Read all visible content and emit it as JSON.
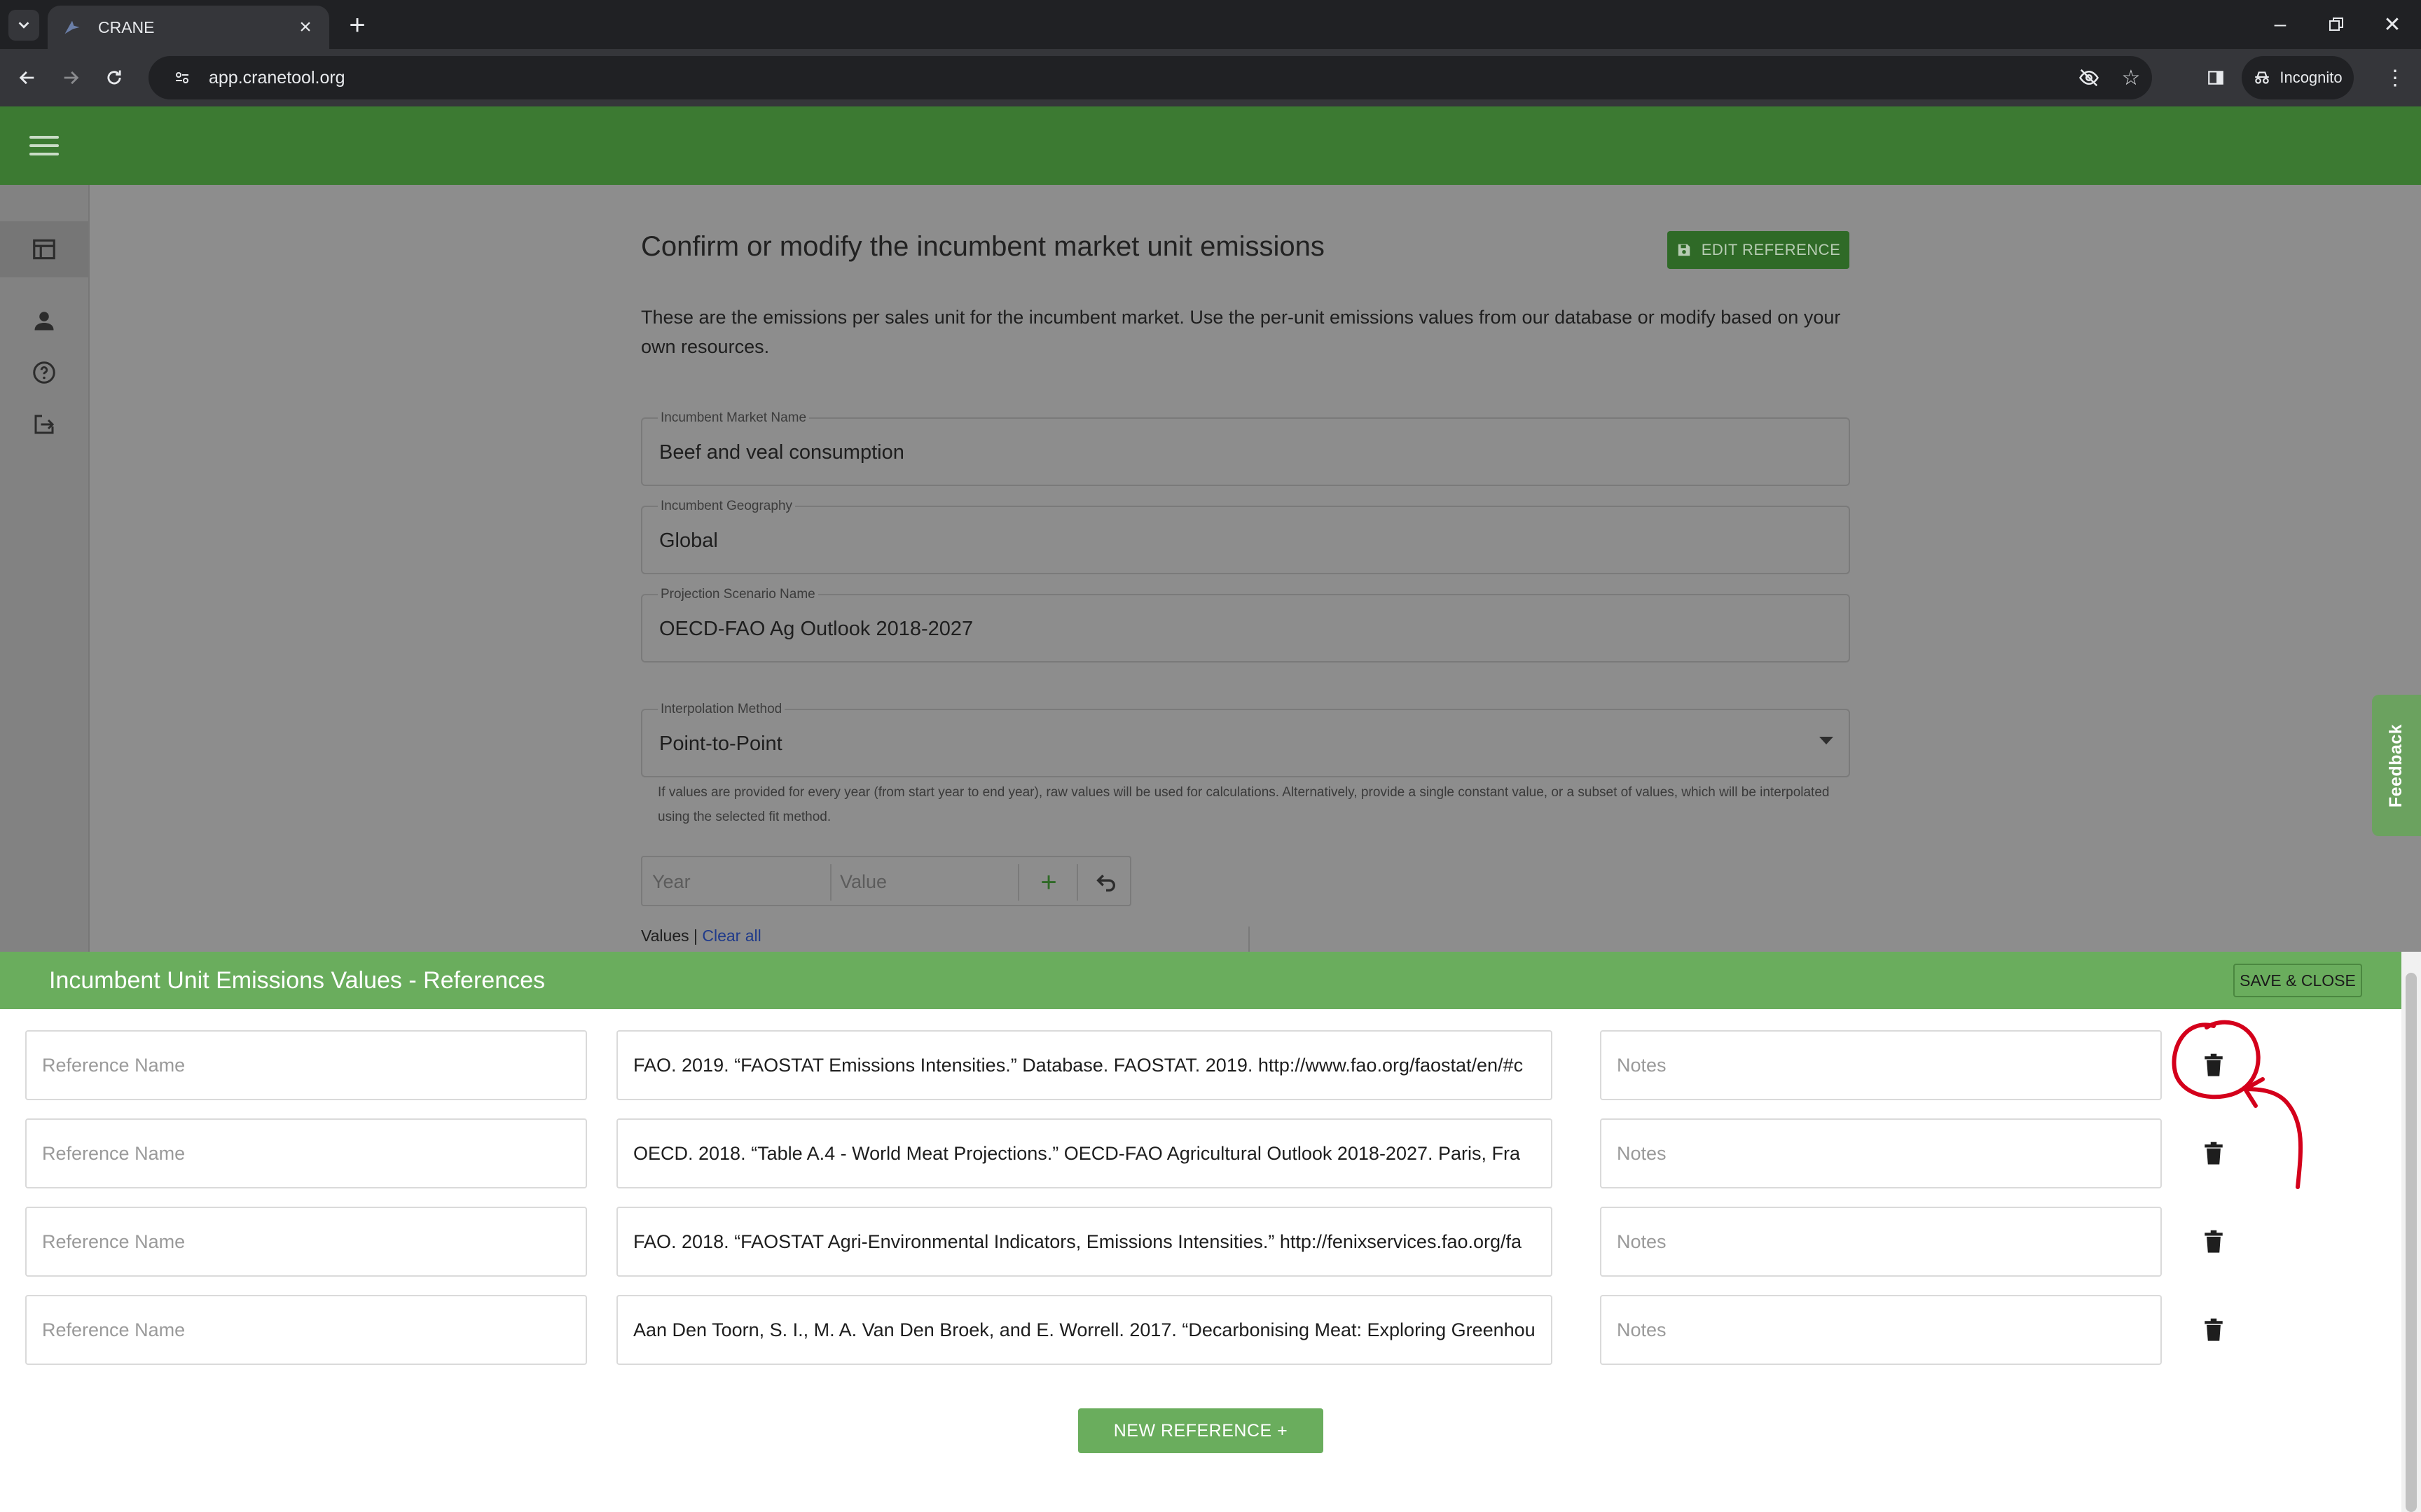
{
  "browser": {
    "tab_title": "CRANE",
    "url": "app.cranetool.org",
    "profile_label": "Incognito"
  },
  "page": {
    "title": "Confirm or modify the incumbent market unit emissions",
    "edit_reference_label": "EDIT REFERENCE",
    "description": "These are the emissions per sales unit for the incumbent market. Use the per-unit emissions values from our database or modify based on your own resources.",
    "fields": [
      {
        "label": "Incumbent Market Name",
        "value": "Beef and veal consumption"
      },
      {
        "label": "Incumbent Geography",
        "value": "Global"
      },
      {
        "label": "Projection Scenario Name",
        "value": "OECD-FAO Ag Outlook 2018-2027"
      }
    ],
    "interpolation": {
      "label": "Interpolation Method",
      "value": "Point-to-Point",
      "helper": "If values are provided for every year (from start year to end year), raw values will be used for calculations. Alternatively, provide a single constant value, or a subset of values, which will be interpolated using the selected fit method."
    },
    "year_placeholder": "Year",
    "value_placeholder": "Value",
    "values_label": "Values |",
    "clear_all_label": "Clear all",
    "feedback_label": "Feedback"
  },
  "drawer": {
    "title": "Incumbent Unit Emissions Values - References",
    "save_close_label": "SAVE & CLOSE",
    "name_placeholder": "Reference Name",
    "notes_placeholder": "Notes",
    "references": [
      {
        "citation": "FAO. 2019. “FAOSTAT Emissions Intensities.” Database. FAOSTAT. 2019. http://www.fao.org/faostat/en/#c"
      },
      {
        "citation": "OECD. 2018. “Table A.4 - World Meat Projections.” OECD-FAO Agricultural Outlook 2018-2027. Paris, Fra"
      },
      {
        "citation": "FAO. 2018. “FAOSTAT Agri-Environmental Indicators, Emissions Intensities.” http://fenixservices.fao.org/fa"
      },
      {
        "citation": "Aan Den Toorn, S. I., M. A. Van Den Broek, and E. Worrell. 2017. “Decarbonising Meat: Exploring Greenhou"
      }
    ],
    "new_reference_label": "NEW REFERENCE +"
  },
  "colors": {
    "app_bar": "#3c7a32",
    "drawer_header": "#6aad5d",
    "annotation": "#d4001b"
  }
}
